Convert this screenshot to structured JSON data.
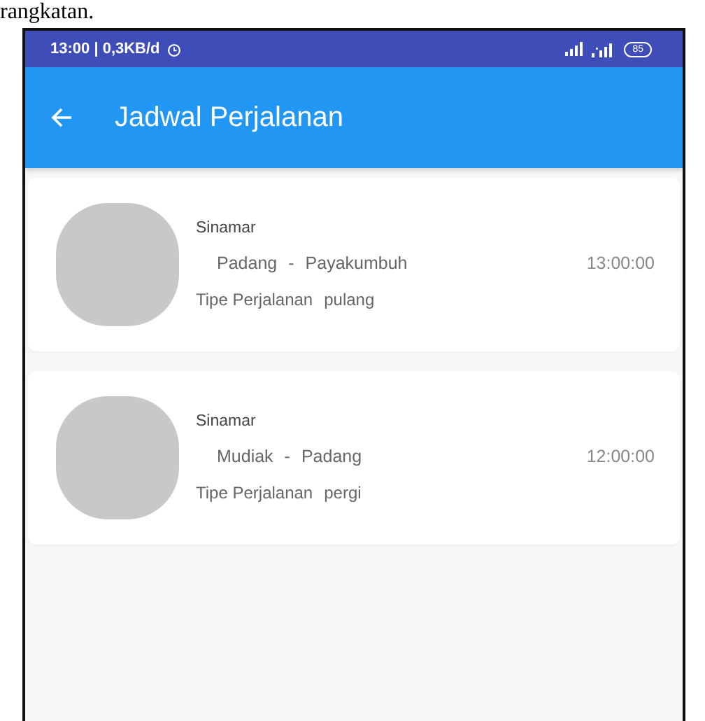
{
  "document_text": "rangkatan.",
  "status_bar": {
    "time": "13:00 | 0,3KB/d",
    "battery": "85"
  },
  "app_bar": {
    "title": "Jadwal Perjalanan"
  },
  "trips": [
    {
      "name": "Sinamar",
      "origin": "Padang",
      "separator": "-",
      "destination": "Payakumbuh",
      "time": "13:00:00",
      "type_label": "Tipe Perjalanan",
      "type": "pulang"
    },
    {
      "name": "Sinamar",
      "origin": "Mudiak",
      "separator": "-",
      "destination": "Padang",
      "time": "12:00:00",
      "type_label": "Tipe Perjalanan",
      "type": "pergi"
    }
  ]
}
